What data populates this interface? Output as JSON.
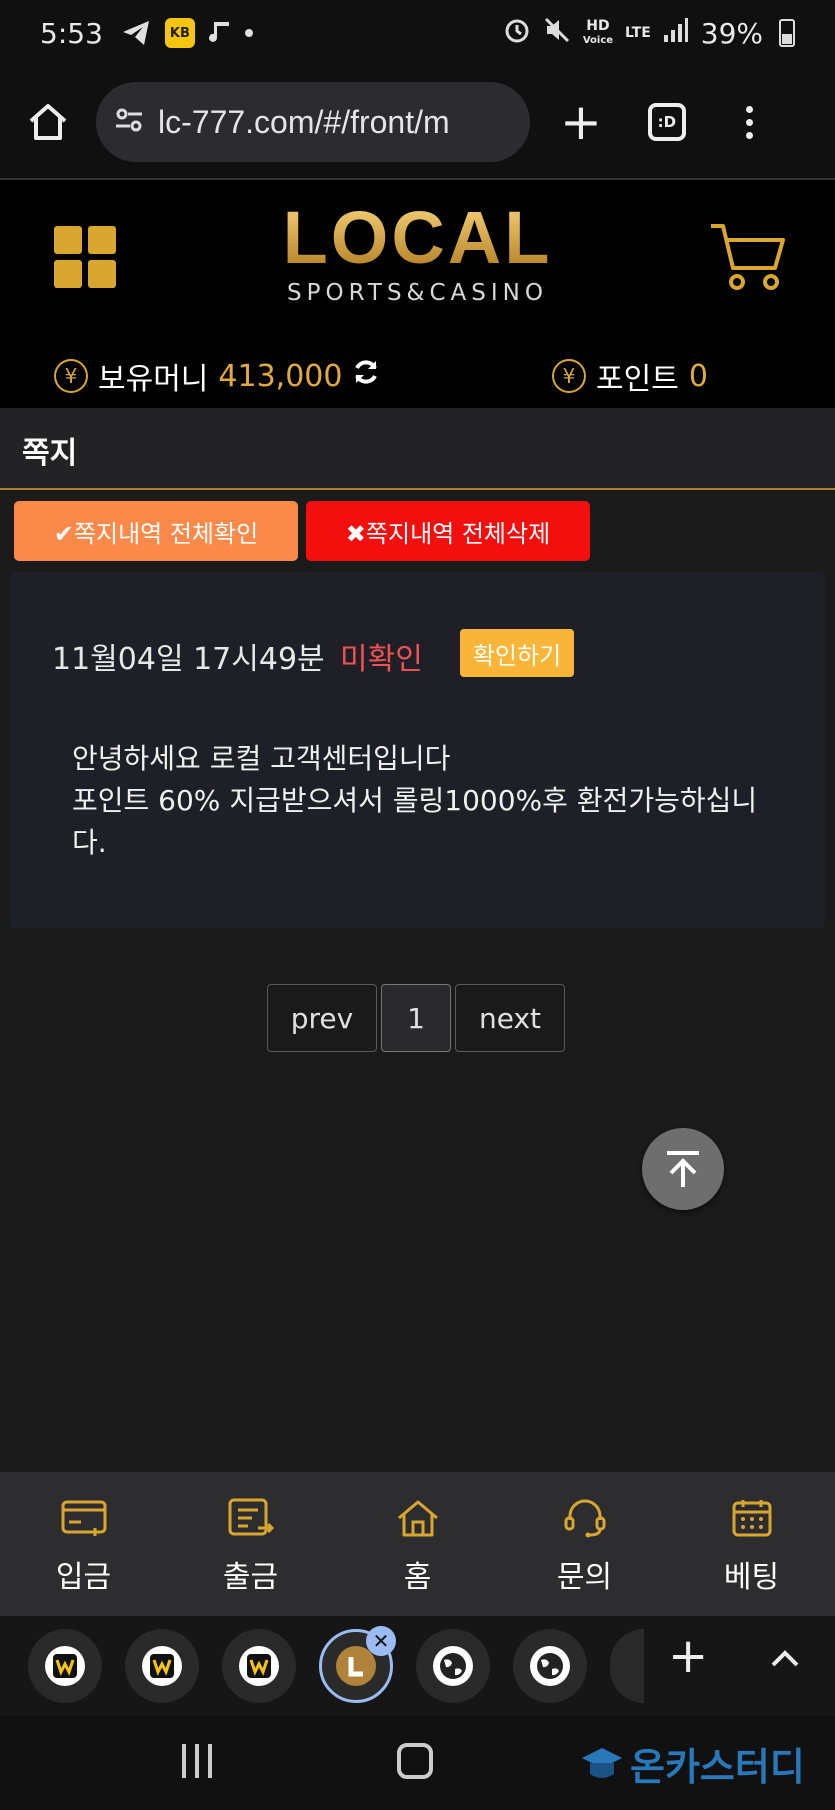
{
  "status_bar": {
    "time": "5:53",
    "app_badge": "KB",
    "hd_label": "HD",
    "voice_label": "Voice",
    "lte_label": "LTE",
    "battery": "39%"
  },
  "browser": {
    "url": "lc-777.com/#/front/m",
    "tabs_label": ":D"
  },
  "site": {
    "logo_main": "LOCAL",
    "logo_sub": "SPORTS&CASINO",
    "money_label": "보유머니",
    "money_value": "413,000",
    "point_label": "포인트",
    "point_value": "0",
    "currency_symbol": "¥"
  },
  "notes": {
    "title": "쪽지",
    "confirm_all_label": "✔쪽지내역 전체확인",
    "delete_all_label": "✖쪽지내역 전체삭제",
    "message": {
      "date": "11월04일 17시49분",
      "status": "미확인",
      "read_button": "확인하기",
      "body": "안녕하세요 로컬 고객센터입니다\n포인트 60% 지급받으셔서 롤링1000%후 환전가능하십니다."
    }
  },
  "pager": {
    "prev": "prev",
    "current": "1",
    "next": "next"
  },
  "bottom_nav": {
    "items": [
      {
        "label": "입금",
        "icon": "deposit-card-icon"
      },
      {
        "label": "출금",
        "icon": "withdraw-doc-icon"
      },
      {
        "label": "홈",
        "icon": "home-icon"
      },
      {
        "label": "문의",
        "icon": "headset-icon"
      },
      {
        "label": "베팅",
        "icon": "calendar-icon"
      }
    ]
  },
  "tab_strip": {
    "tab_count_visible": 7
  },
  "watermark": {
    "text": "온카스터디"
  },
  "colors": {
    "gold": "#d9a630",
    "confirm_button": "#fb8a4a",
    "delete_button": "#f40f0f",
    "unread_status": "#f05252",
    "read_button": "#f8b538"
  }
}
